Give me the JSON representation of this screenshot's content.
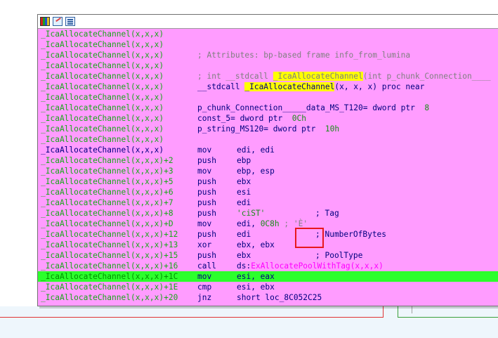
{
  "header": {
    "icons": [
      "color-palette-icon",
      "edit-pen-icon",
      "text-lines-icon"
    ]
  },
  "address_label": "_IcaAllocateChannel(x,x,x)",
  "info": {
    "attributes": "; Attributes: bp-based frame info_from_lumina",
    "proto_prefix": "; int __stdcall ",
    "proto_name": "_IcaAllocateChannel",
    "proto_suffix": "(int p_chunk_Connection____",
    "stdcall_prefix": "__stdcall ",
    "stdcall_name": "_IcaAllocateChannel",
    "stdcall_suffix": "(x, x, x) proc near",
    "var1_name": "p_chunk_Connection_____data_MS_T120",
    "var1_type": "= dword ptr  ",
    "var1_off": "8",
    "var2_name": "const_5",
    "var2_type": "= dword ptr  ",
    "var2_off": "0Ch",
    "var3_name": "p_string_MS120",
    "var3_type": "= dword ptr  ",
    "var3_off": "10h"
  },
  "instructions": [
    {
      "addr": "_IcaAllocateChannel(x,x,x)",
      "mnem": "mov",
      "opnd": "edi, edi",
      "cmt": ""
    },
    {
      "addr": "_IcaAllocateChannel(x,x,x)+2",
      "mnem": "push",
      "opnd": "ebp",
      "cmt": ""
    },
    {
      "addr": "_IcaAllocateChannel(x,x,x)+3",
      "mnem": "mov",
      "opnd": "ebp, esp",
      "cmt": ""
    },
    {
      "addr": "_IcaAllocateChannel(x,x,x)+5",
      "mnem": "push",
      "opnd": "ebx",
      "cmt": ""
    },
    {
      "addr": "_IcaAllocateChannel(x,x,x)+6",
      "mnem": "push",
      "opnd": "esi",
      "cmt": ""
    },
    {
      "addr": "_IcaAllocateChannel(x,x,x)+7",
      "mnem": "push",
      "opnd": "edi",
      "cmt": ""
    },
    {
      "addr": "_IcaAllocateChannel(x,x,x)+8",
      "mnem": "push",
      "opnd": "'ciST'",
      "cmt": "; Tag"
    },
    {
      "addr": "_IcaAllocateChannel(x,x,x)+D",
      "mnem": "mov",
      "opnd_pre": "edi, ",
      "opnd_val": "0C8h",
      "opnd_cmt": " ; 'È'"
    },
    {
      "addr": "_IcaAllocateChannel(x,x,x)+12",
      "mnem": "push",
      "opnd": "edi",
      "cmt": "; NumberOfBytes"
    },
    {
      "addr": "_IcaAllocateChannel(x,x,x)+13",
      "mnem": "xor",
      "opnd": "ebx, ebx",
      "cmt": ""
    },
    {
      "addr": "_IcaAllocateChannel(x,x,x)+15",
      "mnem": "push",
      "opnd": "ebx",
      "cmt": "; PoolType"
    },
    {
      "addr": "_IcaAllocateChannel(x,x,x)+16",
      "mnem": "call",
      "opnd_pre": "ds:",
      "opnd_func": "ExAllocatePoolWithTag(x,x,x)"
    },
    {
      "addr": "_IcaAllocateChannel(x,x,x)+1C",
      "mnem": "mov",
      "opnd": "esi, eax",
      "cmt": ""
    },
    {
      "addr": "_IcaAllocateChannel(x,x,x)+1E",
      "mnem": "cmp",
      "opnd": "esi, ebx",
      "cmt": ""
    },
    {
      "addr": "_IcaAllocateChannel(x,x,x)+20",
      "mnem": "jnz",
      "opnd": "short loc_8C052C25",
      "cmt": ""
    }
  ]
}
